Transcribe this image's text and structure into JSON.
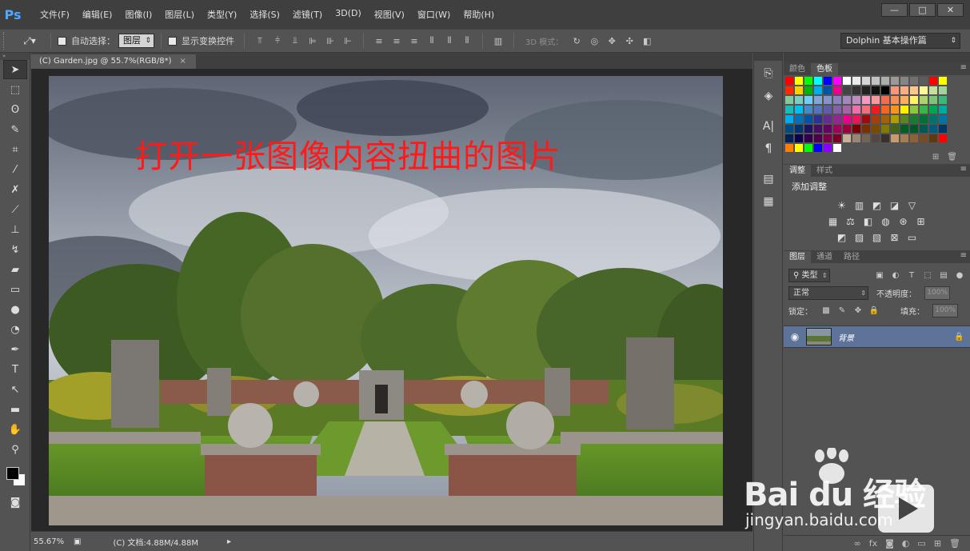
{
  "app": {
    "logo": "Ps"
  },
  "menu": [
    "文件(F)",
    "编辑(E)",
    "图像(I)",
    "图层(L)",
    "类型(Y)",
    "选择(S)",
    "滤镜(T)",
    "3D(D)",
    "视图(V)",
    "窗口(W)",
    "帮助(H)"
  ],
  "window_controls": [
    "—",
    "□",
    "✕"
  ],
  "options": {
    "auto_select_label": "自动选择：",
    "auto_select_value": "图层",
    "show_transform_label": "显示变换控件",
    "mode3d_label": "3D 模式：",
    "workspace": "Dolphin 基本操作篇"
  },
  "document": {
    "tab_title": "(C) Garden.jpg @ 55.7%(RGB/8*)",
    "overlay_text": "打开一张图像内容扭曲的图片"
  },
  "status": {
    "zoom": "55.67%",
    "doc_info": "(C) 文档:4.88M/4.88M"
  },
  "panels": {
    "color_tabs": [
      "颜色",
      "色板"
    ],
    "adjust_tabs": [
      "调整",
      "样式"
    ],
    "add_adjustment": "添加调整",
    "layer_tabs": [
      "图层",
      "通道",
      "路径"
    ],
    "filter_kind": "类型",
    "blend_mode": "正常",
    "opacity_label": "不透明度：",
    "opacity_value": "100%",
    "lock_label": "锁定：",
    "fill_label": "填充：",
    "fill_value": "100%",
    "layer_name": "背景"
  },
  "swatch_colors": [
    "#ff0000",
    "#ffff00",
    "#00ff00",
    "#00ffff",
    "#0000ff",
    "#ff00ff",
    "#ffffff",
    "#ebebeb",
    "#d6d6d6",
    "#c2c2c2",
    "#adadad",
    "#999999",
    "#858585",
    "#707070",
    "#5c5c5c",
    "#ff0000",
    "#ffff00",
    "#ff2a00",
    "#f9d100",
    "#00b600",
    "#00aeef",
    "#0054a6",
    "#ec008c",
    "#444444",
    "#333333",
    "#222222",
    "#111111",
    "#000000",
    "#f7977a",
    "#f9ad81",
    "#fdc68a",
    "#fff79a",
    "#c4df9b",
    "#a3d39c",
    "#82ca9d",
    "#7bcdc8",
    "#6ecff6",
    "#7ea7d8",
    "#8493ca",
    "#8882be",
    "#a187be",
    "#bc8dbf",
    "#f49ac2",
    "#f6989d",
    "#f26c4f",
    "#f68e55",
    "#fbaf5c",
    "#fff467",
    "#acd372",
    "#7cc576",
    "#3bb878",
    "#1abbb4",
    "#00bff3",
    "#438ccb",
    "#5574b9",
    "#605ca8",
    "#855fa8",
    "#a763a8",
    "#f06ea9",
    "#f26d7d",
    "#ed1c24",
    "#f26522",
    "#f7941d",
    "#fff200",
    "#8dc63f",
    "#39b54a",
    "#00a651",
    "#00a99d",
    "#00aeef",
    "#0072bc",
    "#0054a6",
    "#2e3192",
    "#662d91",
    "#92278f",
    "#ec008c",
    "#ed145b",
    "#9e0b0f",
    "#a0410d",
    "#a36209",
    "#aba000",
    "#598527",
    "#1a7b30",
    "#007236",
    "#00746b",
    "#0076a3",
    "#004b80",
    "#003471",
    "#1b1464",
    "#440e62",
    "#630460",
    "#9e005d",
    "#9e0039",
    "#790000",
    "#7b2e00",
    "#7d4900",
    "#827b00",
    "#406618",
    "#005e20",
    "#005826",
    "#005952",
    "#005b7f",
    "#003663",
    "#002157",
    "#0d004c",
    "#32004b",
    "#4b0049",
    "#7b0046",
    "#7a0026",
    "#c7b299",
    "#998675",
    "#736357",
    "#534741",
    "#37302d",
    "#c69c6d",
    "#a67c52",
    "#8c6239",
    "#754c24",
    "#603913",
    "#ff0000",
    "#ff7f00",
    "#ffff00",
    "#00ff00",
    "#0000ff",
    "#8b00ff",
    "#ffffff"
  ]
}
